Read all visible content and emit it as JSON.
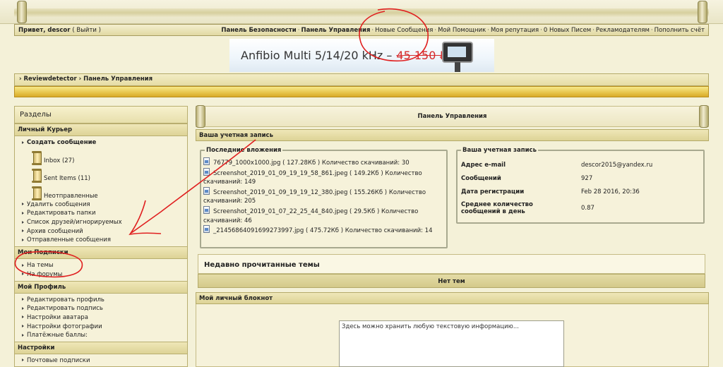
{
  "header": {
    "greeting": "Привет, descor",
    "logout": "( Выйти )",
    "nav": [
      {
        "label": "Панель Безопасности",
        "bold": true
      },
      {
        "label": "Панель Управления",
        "bold": true
      },
      {
        "label": "Новые Сообщения",
        "bold": false
      },
      {
        "label": "Мой Помощник",
        "bold": false
      },
      {
        "label": "Моя репутация",
        "bold": false
      },
      {
        "label": "0 Новых Писем",
        "bold": false
      },
      {
        "label": "Рекламодателям",
        "bold": false
      },
      {
        "label": "Пополнить счёт",
        "bold": false
      }
    ]
  },
  "banner": {
    "text": "Anfibio Multi 5/14/20 kHz –",
    "price": "45 150 ₽"
  },
  "breadcrumb": "› Reviewdetector › Панель Управления",
  "sidebar": {
    "title": "Разделы",
    "sections": [
      {
        "title": "Личный Курьер",
        "create": "Создать сообщение",
        "folders": [
          "Inbox (27)",
          "Sent Items (11)",
          "Неотправленные"
        ],
        "items": [
          "Удалить сообщения",
          "Редактировать папки",
          "Список друзей/игнорируемых",
          "Архив сообщений",
          "Отправленные сообщения"
        ]
      },
      {
        "title": "Мои Подписки",
        "items": [
          "На темы",
          "На форумы"
        ]
      },
      {
        "title": "Мой Профиль",
        "items": [
          "Редактировать профиль",
          "Редактировать подпись",
          "Настройки аватара",
          "Настройки фотографии",
          "Платёжные баллы:"
        ]
      },
      {
        "title": "Настройки",
        "items": [
          "Почтовые подписки"
        ]
      }
    ]
  },
  "main": {
    "title": "Панель Управления",
    "account_header": "Ваша учетная запись",
    "attachments": {
      "legend": "Последние вложения",
      "files": [
        {
          "name": "76779_1000x1000.jpg",
          "size": "( 127.28Кб )",
          "dl": "Количество скачиваний: 30"
        },
        {
          "name": "Screenshot_2019_01_09_19_19_58_861.jpeg",
          "size": "( 149.2Кб )",
          "dl": "Количество скачиваний: 149"
        },
        {
          "name": "Screenshot_2019_01_09_19_19_12_380.jpeg",
          "size": "( 155.26Кб )",
          "dl": "Количество скачиваний: 205"
        },
        {
          "name": "Screenshot_2019_01_07_22_25_44_840.jpeg",
          "size": "( 29.5Кб )",
          "dl": "Количество скачиваний: 46"
        },
        {
          "name": "_21456864091699273997.jpg",
          "size": "( 475.72Кб )",
          "dl": "Количество скачиваний: 14"
        }
      ]
    },
    "account": {
      "legend": "Ваша учетная запись",
      "rows": [
        {
          "k": "Адрес e-mail",
          "v": "descor2015@yandex.ru"
        },
        {
          "k": "Сообщений",
          "v": "927"
        },
        {
          "k": "Дата регистрации",
          "v": "Feb 28 2016, 20:36"
        },
        {
          "k": "Среднее количество сообщений в день",
          "v": "0.87"
        }
      ]
    },
    "recent": {
      "title": "Недавно прочитанные темы",
      "none": "Нет тем"
    },
    "notepad": {
      "title": "Мой личный блокнот",
      "placeholder": "Здесь можно хранить любую текстовую информацию..."
    }
  }
}
